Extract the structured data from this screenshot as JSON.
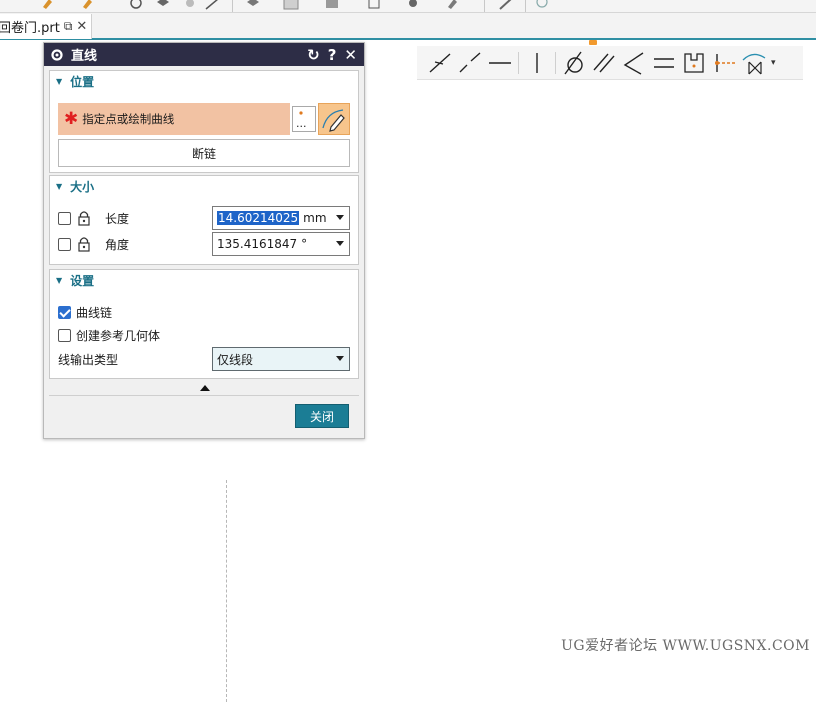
{
  "file_tab": {
    "name": "回卷门.prt"
  },
  "watermark": "UG爱好者论坛 WWW.UGSNX.COM",
  "dialog": {
    "title": "直线",
    "position_group": {
      "title": "位置",
      "select_label": "指定点或绘制曲线",
      "dots_label": "...",
      "break_chain_label": "断链"
    },
    "size_group": {
      "title": "大小",
      "length_label": "长度",
      "length_value": "14.60214025",
      "length_unit": "mm",
      "angle_label": "角度",
      "angle_value": "135.4161847",
      "angle_unit": "°"
    },
    "settings_group": {
      "title": "设置",
      "curve_chain_label": "曲线链",
      "curve_chain_checked": true,
      "create_ref_label": "创建参考几何体",
      "create_ref_checked": false,
      "output_type_label": "线输出类型",
      "output_type_value": "仅线段"
    },
    "close_label": "关闭"
  },
  "sketch_toolbar": {
    "icons": [
      "point-dotted-line-icon",
      "dashed-line-icon",
      "horizontal-line-icon",
      "vertical-line-icon",
      "tangent-circle-icon",
      "parallel-lines-icon",
      "angle-icon",
      "equal-icon",
      "midpoint-box-icon",
      "point-on-line-icon",
      "symmetric-curve-icon"
    ]
  },
  "colors": {
    "accent": "#1b7d95",
    "title_bar": "#2d2d46",
    "selection_highlight": "#f2c2a3"
  }
}
